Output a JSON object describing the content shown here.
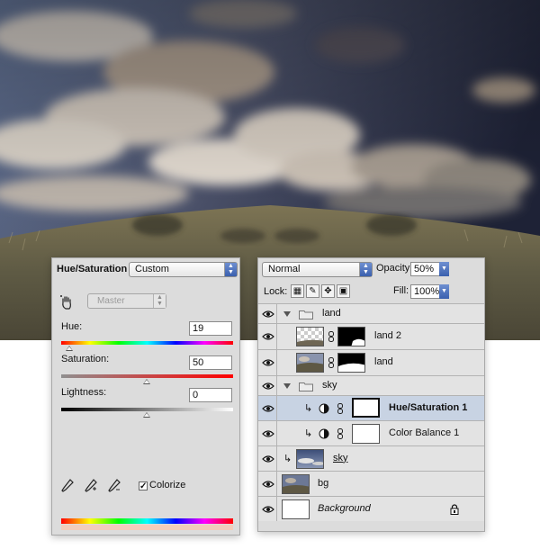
{
  "hue_saturation": {
    "title": "Hue/Saturation",
    "preset": "Custom",
    "edit_range": "Master",
    "hue_label": "Hue:",
    "hue_value": "19",
    "saturation_label": "Saturation:",
    "saturation_value": "50",
    "lightness_label": "Lightness:",
    "lightness_value": "0",
    "colorize_label": "Colorize",
    "colorize_checked": true,
    "slider_levels": {
      "hue": 19,
      "saturation": 50,
      "lightness": 0
    }
  },
  "layers_panel": {
    "blend_mode": "Normal",
    "opacity_label": "Opacity:",
    "opacity_value": "50%",
    "lock_label": "Lock:",
    "fill_label": "Fill:",
    "fill_value": "100%",
    "layers": [
      {
        "name": "land",
        "kind": "group"
      },
      {
        "name": "land 2",
        "kind": "layer-mask"
      },
      {
        "name": "land",
        "kind": "layer-mask"
      },
      {
        "name": "sky",
        "kind": "group"
      },
      {
        "name": "Hue/Saturation 1",
        "kind": "adjustment",
        "selected": true
      },
      {
        "name": "Color Balance 1",
        "kind": "adjustment"
      },
      {
        "name": "sky",
        "kind": "layer"
      },
      {
        "name": "bg",
        "kind": "layer"
      },
      {
        "name": "Background",
        "kind": "locked-layer"
      }
    ]
  },
  "colors": {
    "panel_bg": "#dcdcdc",
    "selected_row": "#c8d3e3",
    "accent_blue": "#3a5fae"
  }
}
